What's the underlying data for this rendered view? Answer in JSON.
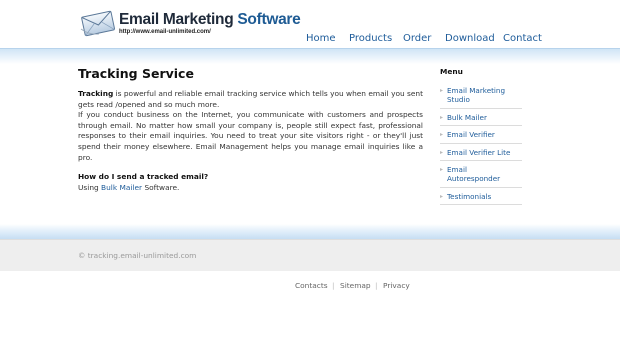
{
  "header": {
    "logo_title_main": "Email Marketing",
    "logo_title_accent": "Software",
    "logo_url": "http://www.email-unlimited.com/"
  },
  "nav": {
    "items": [
      {
        "label": "Home"
      },
      {
        "label": "Products"
      },
      {
        "label": "Order"
      },
      {
        "label": "Download"
      },
      {
        "label": "Contact"
      }
    ]
  },
  "main": {
    "title": "Tracking Service",
    "intro_bold": "Tracking",
    "intro_rest": " is powerful and reliable email tracking service which tells you when email you sent gets read /opened  and so much more.",
    "paragraph2": "If you conduct business on the Internet, you communicate with customers and prospects through email. No matter how small your company is, people still expect fast, professional responses to their email inquiries. You need to treat your site visitors right - or they'll just spend their money elsewhere. Email Management helps you manage email inquiries like a pro.",
    "question": "How do I send a tracked email?",
    "using_prefix": "Using ",
    "using_link": "Bulk Mailer",
    "using_suffix": " Software."
  },
  "sidebar": {
    "title": "Menu",
    "items": [
      {
        "label": "Email Marketing Studio"
      },
      {
        "label": "Bulk Mailer"
      },
      {
        "label": "Email Verifier"
      },
      {
        "label": "Email Verifier Lite"
      },
      {
        "label": "Email Autoresponder"
      },
      {
        "label": "Testimonials"
      }
    ]
  },
  "footer": {
    "copyright": "© tracking.email-unlimited.com",
    "links": [
      {
        "label": "Contacts"
      },
      {
        "label": "Sitemap"
      },
      {
        "label": "Privacy"
      }
    ],
    "separator": "|"
  },
  "colors": {
    "link": "#1e5c9a",
    "band": "#cde3f5",
    "footer_bg": "#eeeeee"
  }
}
